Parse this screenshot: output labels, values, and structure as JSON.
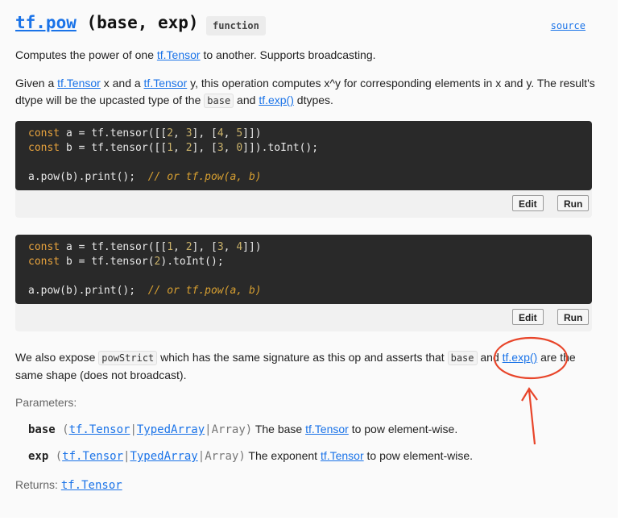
{
  "header": {
    "fn_name": "tf.pow",
    "signature": " (base, exp)",
    "badge": "function",
    "source_link": "source"
  },
  "intro": {
    "p1_before": "Computes the power of one ",
    "p1_link": "tf.Tensor",
    "p1_after": " to another. Supports broadcasting.",
    "p2_a": "Given a ",
    "p2_link1": "tf.Tensor",
    "p2_b": " x and a ",
    "p2_link2": "tf.Tensor",
    "p2_c": " y, this operation computes x^y for corresponding elements in x and y. The result's dtype will be the upcasted type of the ",
    "p2_code": "base",
    "p2_d": " and ",
    "p2_link3": "tf.exp()",
    "p2_e": " dtypes."
  },
  "examples": [
    {
      "line1": [
        "const",
        " a = tf.tensor([[",
        "2",
        ", ",
        "3",
        "], [",
        "4",
        ", ",
        "5",
        "]])"
      ],
      "line2": [
        "const",
        " b = tf.tensor([[",
        "1",
        ", ",
        "2",
        "], [",
        "3",
        ", ",
        "0",
        "]]).toInt();"
      ],
      "line3_code": "a.pow(b).print();  ",
      "line3_comment": "// or tf.pow(a, b)",
      "edit": "Edit",
      "run": "Run"
    },
    {
      "line1": [
        "const",
        " a = tf.tensor([[",
        "1",
        ", ",
        "2",
        "], [",
        "3",
        ", ",
        "4",
        "]])"
      ],
      "line2_pre": "const",
      "line2_a": " b = tf.tensor(",
      "line2_num": "2",
      "line2_b": ").toInt();",
      "line3_code": "a.pow(b).print();  ",
      "line3_comment": "// or tf.pow(a, b)",
      "edit": "Edit",
      "run": "Run"
    }
  ],
  "strict": {
    "a": "We also expose ",
    "code1": "powStrict",
    "b": " which has the same signature as this op and asserts that ",
    "code2": "base",
    "c": " and ",
    "link": "tf.exp()",
    "d": " are the same shape (does not broadcast)."
  },
  "params_label": "Parameters:",
  "params": [
    {
      "name": "base",
      "open": " (",
      "t1": "tf.Tensor",
      "sep1": "|",
      "t2": "TypedArray",
      "sep2": "|",
      "t3": "Array",
      "close": ")",
      "desc_a": " The base ",
      "desc_link": "tf.Tensor",
      "desc_b": " to pow element-wise."
    },
    {
      "name": "exp",
      "open": " (",
      "t1": "tf.Tensor",
      "sep1": "|",
      "t2": "TypedArray",
      "sep2": "|",
      "t3": "Array",
      "close": ")",
      "desc_a": " The exponent ",
      "desc_link": "tf.Tensor",
      "desc_b": " to pow element-wise."
    }
  ],
  "returns_label": "Returns: ",
  "returns_type": "tf.Tensor",
  "colors": {
    "link": "#1a73e8",
    "annotation": "#e8452a",
    "code_bg": "#292929"
  }
}
